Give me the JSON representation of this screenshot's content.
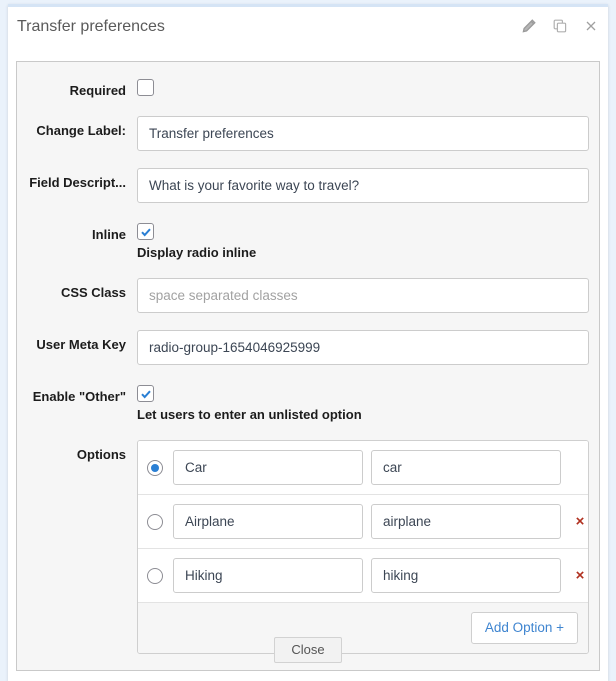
{
  "dialog": {
    "title": "Transfer preferences",
    "header_icons": [
      {
        "name": "edit-pencil-icon",
        "label": "Edit"
      },
      {
        "name": "duplicate-icon",
        "label": "Duplicate"
      },
      {
        "name": "close-icon",
        "label": "Close"
      }
    ]
  },
  "fields": {
    "required": {
      "label": "Required",
      "checked": false
    },
    "change_label": {
      "label": "Change Label:",
      "value": "Transfer preferences",
      "placeholder": ""
    },
    "field_description": {
      "label": "Field Descript...",
      "value": "What is your favorite way to travel?",
      "placeholder": ""
    },
    "inline": {
      "label": "Inline",
      "checked": true,
      "hint": "Display radio inline"
    },
    "css_class": {
      "label": "CSS Class",
      "value": "",
      "placeholder": "space separated classes"
    },
    "user_meta_key": {
      "label": "User Meta Key",
      "value": "radio-group-1654046925999",
      "placeholder": ""
    },
    "enable_other": {
      "label": "Enable \"Other\"",
      "checked": true,
      "hint": "Let users to enter an unlisted option"
    },
    "options": {
      "label": "Options",
      "rows": [
        {
          "selected": true,
          "label": "Car",
          "value": "car",
          "removable": false,
          "remove_label": "×"
        },
        {
          "selected": false,
          "label": "Airplane",
          "value": "airplane",
          "removable": true,
          "remove_label": "×"
        },
        {
          "selected": false,
          "label": "Hiking",
          "value": "hiking",
          "removable": true,
          "remove_label": "×"
        }
      ],
      "add_button": "Add Option +"
    }
  },
  "footer": {
    "close_label": "Close"
  },
  "colors": {
    "accent_blue": "#2a7fd4",
    "link_blue": "#3f85d0",
    "remove_red": "#b0301f",
    "panel_bg": "#f6f6f6",
    "page_bg": "#eaf2fb"
  }
}
